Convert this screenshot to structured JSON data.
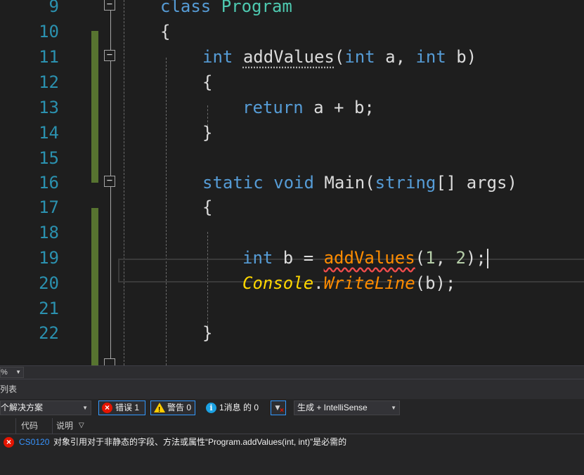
{
  "editor": {
    "line_numbers": [
      "9",
      "10",
      "11",
      "12",
      "13",
      "14",
      "15",
      "16",
      "17",
      "18",
      "19",
      "20",
      "21",
      "22"
    ],
    "code": {
      "l9_kw": "class",
      "l9_cls": "Program",
      "l10": "{",
      "l11_kw1": "int",
      "l11_method": "addValues",
      "l11_p1": "(",
      "l11_kw2": "int",
      "l11_a": " a, ",
      "l11_kw3": "int",
      "l11_b": " b)",
      "l12": "{",
      "l13_kw": "return",
      "l13_rest": " a + b;",
      "l14": "}",
      "l16_kw1": "static",
      "l16_kw2": "void",
      "l16_method": "Main",
      "l16_p": "(",
      "l16_kw3": "string",
      "l16_rest": "[] args)",
      "l17": "{",
      "l19_kw": "int",
      "l19_mid": " b = ",
      "l19_method": "addValues",
      "l19_p1": "(",
      "l19_n1": "1",
      "l19_comma": ", ",
      "l19_n2": "2",
      "l19_end": ");",
      "l20_cls": "Console",
      "l20_dot": ".",
      "l20_method": "WriteLine",
      "l20_rest": "(b);",
      "l22": "}"
    }
  },
  "zoom": {
    "value": "%"
  },
  "error_list": {
    "title": "列表",
    "scope": "个解决方案",
    "errors_label": "错误 1",
    "warnings_label": "警告 0",
    "messages_label": "1消息 的 0",
    "source": "生成 + IntelliSense",
    "headers": {
      "code": "代码",
      "description": "说明"
    },
    "rows": [
      {
        "code": "CS0120",
        "description": "对象引用对于非静态的字段、方法或属性“Program.addValues(int, int)”是必需的"
      }
    ]
  }
}
